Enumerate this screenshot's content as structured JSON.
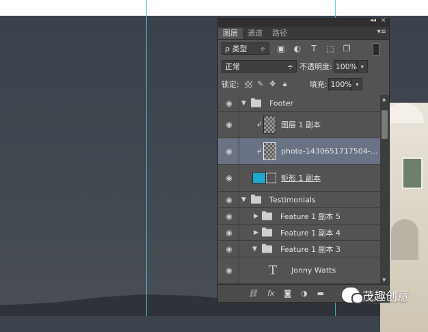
{
  "panel": {
    "tabs": [
      "图层",
      "通道",
      "路径"
    ],
    "collapse_glyph": "◂◂",
    "close_glyph": "×",
    "menu_glyph": "▾≡",
    "filter": {
      "label": "ρ 类型",
      "arrow": "÷"
    },
    "filter_icons": [
      "image-icon",
      "adjust-icon",
      "type-icon",
      "shape-icon",
      "smartobject-icon"
    ],
    "blend_mode": "正常",
    "opacity_label": "不透明度:",
    "opacity_value": "100%",
    "lock_label": "锁定:",
    "fill_label": "填充:",
    "fill_value": "100%",
    "layers": [
      {
        "name": "Footer",
        "type": "group",
        "expanded": true,
        "indent": 0
      },
      {
        "name": "图层 1 副本",
        "type": "pixel",
        "clipped": true,
        "indent": 1
      },
      {
        "name": "photo-1430651717504-...",
        "type": "smart",
        "clipped": true,
        "selected": true,
        "indent": 1
      },
      {
        "name": "矩形 1 副本",
        "type": "shape",
        "thumb_color": "#1fa7cf",
        "indent": 1
      },
      {
        "name": "Testimonials",
        "type": "group",
        "expanded": true,
        "indent": 0
      },
      {
        "name": "Feature 1 副本 5",
        "type": "group",
        "expanded": false,
        "indent": 1
      },
      {
        "name": "Feature 1 副本 4",
        "type": "group",
        "expanded": false,
        "indent": 1
      },
      {
        "name": "Feature 1 副本 3",
        "type": "group",
        "expanded": true,
        "indent": 1
      },
      {
        "name": "Jonny Watts",
        "type": "text",
        "indent": 2
      }
    ],
    "bottom_icons": [
      "link-icon",
      "fx-icon",
      "mask-icon",
      "adjustment-icon",
      "folder-icon"
    ]
  },
  "watermark": {
    "text": "茂趣创意"
  },
  "colors": {
    "accent_guide": "#3ec7d3",
    "panel_bg": "#535353",
    "selected": "#6a7386"
  }
}
